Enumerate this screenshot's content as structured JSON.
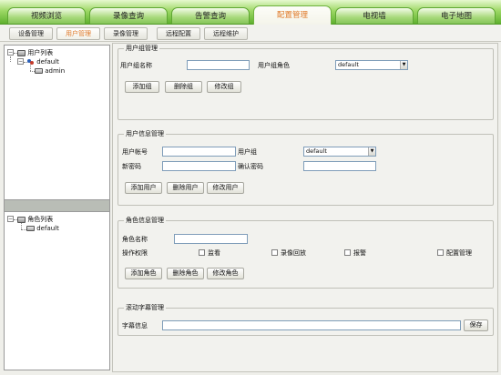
{
  "main_tabs": [
    {
      "label": "视频浏览"
    },
    {
      "label": "录像查询"
    },
    {
      "label": "告警查询"
    },
    {
      "label": "配置管理"
    },
    {
      "label": "电视墙"
    },
    {
      "label": "电子地图"
    }
  ],
  "active_main_tab": "配置管理",
  "sub_tabs": [
    {
      "label": "设备管理"
    },
    {
      "label": "用户管理"
    },
    {
      "label": "录像管理"
    },
    {
      "label": "远程配置"
    },
    {
      "label": "远程维护"
    }
  ],
  "active_sub_tab": "用户管理",
  "user_tree": {
    "root_label": "用户列表",
    "group_label": "default",
    "user_label": "admin"
  },
  "role_tree": {
    "root_label": "角色列表",
    "role_label": "default"
  },
  "user_group_mgmt": {
    "title": "用户组管理",
    "name_label": "用户组名称",
    "name_value": "",
    "role_label": "用户组角色",
    "role_selected": "default",
    "add_btn": "添加组",
    "delete_btn": "删除组",
    "modify_btn": "修改组"
  },
  "user_info_mgmt": {
    "title": "用户信息管理",
    "account_label": "用户帐号",
    "account_value": "",
    "group_label": "用户组",
    "group_selected": "default",
    "new_pwd_label": "新密码",
    "new_pwd_value": "",
    "confirm_pwd_label": "确认密码",
    "confirm_pwd_value": "",
    "add_btn": "添加用户",
    "delete_btn": "删除用户",
    "modify_btn": "修改用户"
  },
  "role_info_mgmt": {
    "title": "角色信息管理",
    "name_label": "角色名称",
    "name_value": "",
    "permission_label": "操作权限",
    "perm_monitor": "监看",
    "perm_playback": "录像回放",
    "perm_alarm": "报警",
    "perm_config": "配置管理",
    "add_btn": "添加角色",
    "delete_btn": "删除角色",
    "modify_btn": "修改角色"
  },
  "scroll_caption_mgmt": {
    "title": "滚动字幕管理",
    "caption_label": "字幕信息",
    "caption_value": "",
    "save_btn": "保存"
  },
  "colors": {
    "tab_green": "#5fb12e",
    "active_orange": "#e07a2a"
  },
  "icons": {
    "tree_root": "list-icon",
    "tree_group": "group-icon",
    "tree_user": "user-icon"
  }
}
